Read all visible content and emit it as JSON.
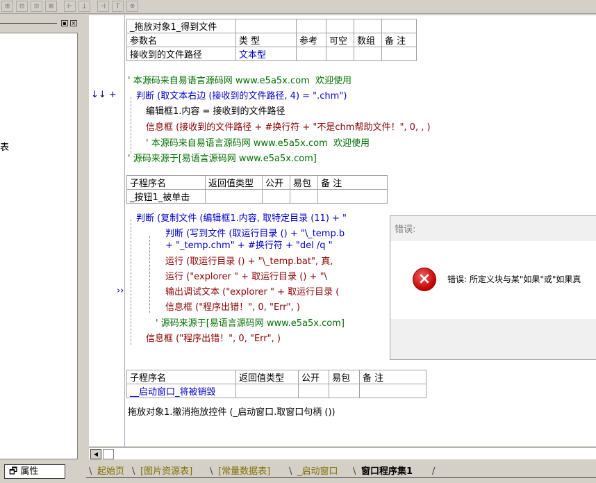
{
  "icons": [
    "layout-icon",
    "close-x-icon",
    "minimize-icon",
    "error-icon",
    "scroll-left-arrow-icon",
    "properties-icon"
  ],
  "left_panel": {
    "partial_text": "表",
    "attr_tab_label": "属性"
  },
  "proc1": {
    "name": "_拖放对象1_得到文件",
    "param_headers": [
      "参数名",
      "类 型",
      "参考",
      "可空",
      "数组",
      "备 注"
    ],
    "param_name": "接收到的文件路径",
    "param_type": "文本型"
  },
  "code1": {
    "l1": "' 本源码来自易语言源码网 www.e5a5x.com  欢迎使用",
    "l2": "判断 (取文本右边 (接收到的文件路径, 4) = \".chm\")",
    "l3": "编辑框1.内容 = 接收到的文件路径",
    "l4": "信息框 (接收到的文件路径 + #换行符 + \"不是chm帮助文件！\", 0, , )",
    "l5": "' 本源码来自易语言源码网 www.e5a5x.com  欢迎使用",
    "l6": "' 源码来源于[易语言源码网 www.e5a5x.com]",
    "marker": "↓↓ +"
  },
  "proc2": {
    "headers": [
      "子程序名",
      "返回值类型",
      "公开",
      "易包",
      "备 注"
    ],
    "name": "_按钮1_被单击"
  },
  "code2": {
    "l1": "判断 (复制文件 (编辑框1.内容, 取特定目录 (11) + \"",
    "l2": "判断 (写到文件 (取运行目录 () + \"\\_temp.b",
    "l3": "+ \"_temp.chm\" + #换行符 + \"del /q \"",
    "l4": "运行 (取运行目录 () + \"\\_temp.bat\", 真,",
    "l5": "运行 (\"explorer \" + 取运行目录 () + \"\\",
    "l6": "输出调试文本 (\"explorer \" + 取运行目录 (",
    "l7": "信息框 (\"程序出错！\", 0, \"Err\", )",
    "l8": "' 源码来源于[易语言源码网 www.e5a5x.com]",
    "l9": "信息框 (\"程序出错！\", 0, \"Err\", )",
    "marker": "››"
  },
  "proc3": {
    "headers": [
      "子程序名",
      "返回值类型",
      "公开",
      "易包",
      "备 注"
    ],
    "name": "__启动窗口_将被销毁",
    "code": "拖放对象1.撤消拖放控件 (_启动窗口.取窗口句柄 ())"
  },
  "dialog": {
    "title": "错误:",
    "message": "错误: 所定义块与某\"如果\"或\"如果真"
  },
  "tabs": [
    "起始页",
    "[图片资源表]",
    "[常量数据表]",
    "_启动窗口",
    "窗口程序集1"
  ]
}
